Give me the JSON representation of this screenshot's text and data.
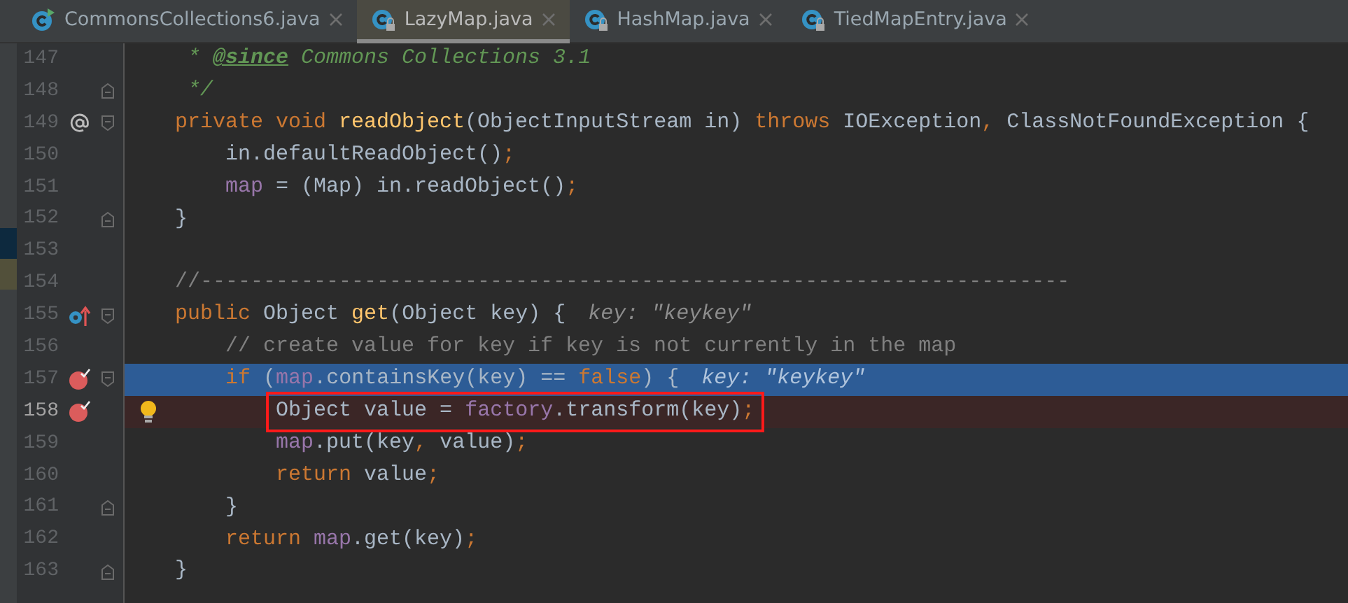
{
  "tabs": [
    {
      "label": "CommonsCollections6.java",
      "kind": "runnable",
      "selected": false
    },
    {
      "label": "LazyMap.java",
      "kind": "library",
      "selected": true
    },
    {
      "label": "HashMap.java",
      "kind": "library",
      "selected": false
    },
    {
      "label": "TiedMapEntry.java",
      "kind": "library",
      "selected": false
    }
  ],
  "lines": [
    {
      "number": "147",
      "tokens": [
        {
          "kind": "doc",
          "text": "     * "
        },
        {
          "kind": "doc_tag",
          "text": "@since"
        },
        {
          "kind": "doc",
          "text": " Commons Collections 3.1"
        }
      ]
    },
    {
      "number": "148",
      "fold_end": true,
      "tokens": [
        {
          "kind": "doc",
          "text": "     */"
        }
      ]
    },
    {
      "number": "149",
      "annotated": true,
      "fold_start": true,
      "tokens": [
        {
          "kind": "keyword",
          "text": "    private void "
        },
        {
          "kind": "declaration",
          "text": "readObject"
        },
        {
          "kind": "plain",
          "text": "(ObjectInputStream in) "
        },
        {
          "kind": "keyword",
          "text": "throws "
        },
        {
          "kind": "plain",
          "text": "IOException"
        },
        {
          "kind": "keyword",
          "text": ", "
        },
        {
          "kind": "plain",
          "text": "ClassNotFoundException {"
        }
      ]
    },
    {
      "number": "150",
      "tokens": [
        {
          "kind": "plain",
          "text": "        in.defaultReadObject()"
        },
        {
          "kind": "keyword",
          "text": ";"
        }
      ]
    },
    {
      "number": "151",
      "tokens": [
        {
          "kind": "field",
          "text": "        map"
        },
        {
          "kind": "plain",
          "text": " = (Map) in.readObject()"
        },
        {
          "kind": "keyword",
          "text": ";"
        }
      ]
    },
    {
      "number": "152",
      "fold_end": true,
      "tokens": [
        {
          "kind": "plain",
          "text": "    }"
        }
      ]
    },
    {
      "number": "153"
    },
    {
      "number": "154",
      "tokens": [
        {
          "kind": "comment",
          "text": "    //---------------------------------------------------------------------"
        }
      ]
    },
    {
      "number": "155",
      "overrides": true,
      "fold_start": true,
      "tokens": [
        {
          "kind": "keyword",
          "text": "    public "
        },
        {
          "kind": "plain",
          "text": "Object "
        },
        {
          "kind": "declaration",
          "text": "get"
        },
        {
          "kind": "plain",
          "text": "(Object key) {"
        },
        {
          "kind": "hint",
          "text": "key: \"keykey\""
        }
      ]
    },
    {
      "number": "156",
      "tokens": [
        {
          "kind": "comment",
          "text": "        // create value for key if key is not currently in the map"
        }
      ]
    },
    {
      "number": "157",
      "breakpoint": true,
      "execution_point": true,
      "fold_start": true,
      "tokens": [
        {
          "kind": "keyword",
          "text": "        if "
        },
        {
          "kind": "plain",
          "text": "("
        },
        {
          "kind": "field",
          "text": "map"
        },
        {
          "kind": "plain",
          "text": ".containsKey(key) == "
        },
        {
          "kind": "keyword",
          "text": "false"
        },
        {
          "kind": "plain",
          "text": ") {"
        },
        {
          "kind": "hint",
          "text": "key: \"keykey\""
        }
      ]
    },
    {
      "number": "158",
      "breakpoint": true,
      "current": true,
      "bulb": true,
      "boxed": true,
      "tokens": [
        {
          "kind": "plain",
          "text": "            Object value = "
        },
        {
          "kind": "field",
          "text": "factory"
        },
        {
          "kind": "plain",
          "text": ".transform(key)"
        },
        {
          "kind": "keyword",
          "text": ";"
        }
      ]
    },
    {
      "number": "159",
      "tokens": [
        {
          "kind": "field",
          "text": "            map"
        },
        {
          "kind": "plain",
          "text": ".put(key"
        },
        {
          "kind": "keyword",
          "text": ", "
        },
        {
          "kind": "plain",
          "text": "value)"
        },
        {
          "kind": "keyword",
          "text": ";"
        }
      ]
    },
    {
      "number": "160",
      "tokens": [
        {
          "kind": "keyword",
          "text": "            return "
        },
        {
          "kind": "plain",
          "text": "value"
        },
        {
          "kind": "keyword",
          "text": ";"
        }
      ]
    },
    {
      "number": "161",
      "fold_end": true,
      "tokens": [
        {
          "kind": "plain",
          "text": "        }"
        }
      ]
    },
    {
      "number": "162",
      "tokens": [
        {
          "kind": "keyword",
          "text": "        return "
        },
        {
          "kind": "field",
          "text": "map"
        },
        {
          "kind": "plain",
          "text": ".get(key)"
        },
        {
          "kind": "keyword",
          "text": ";"
        }
      ]
    },
    {
      "number": "163",
      "fold_end": true,
      "tokens": [
        {
          "kind": "plain",
          "text": "    }"
        }
      ]
    }
  ]
}
